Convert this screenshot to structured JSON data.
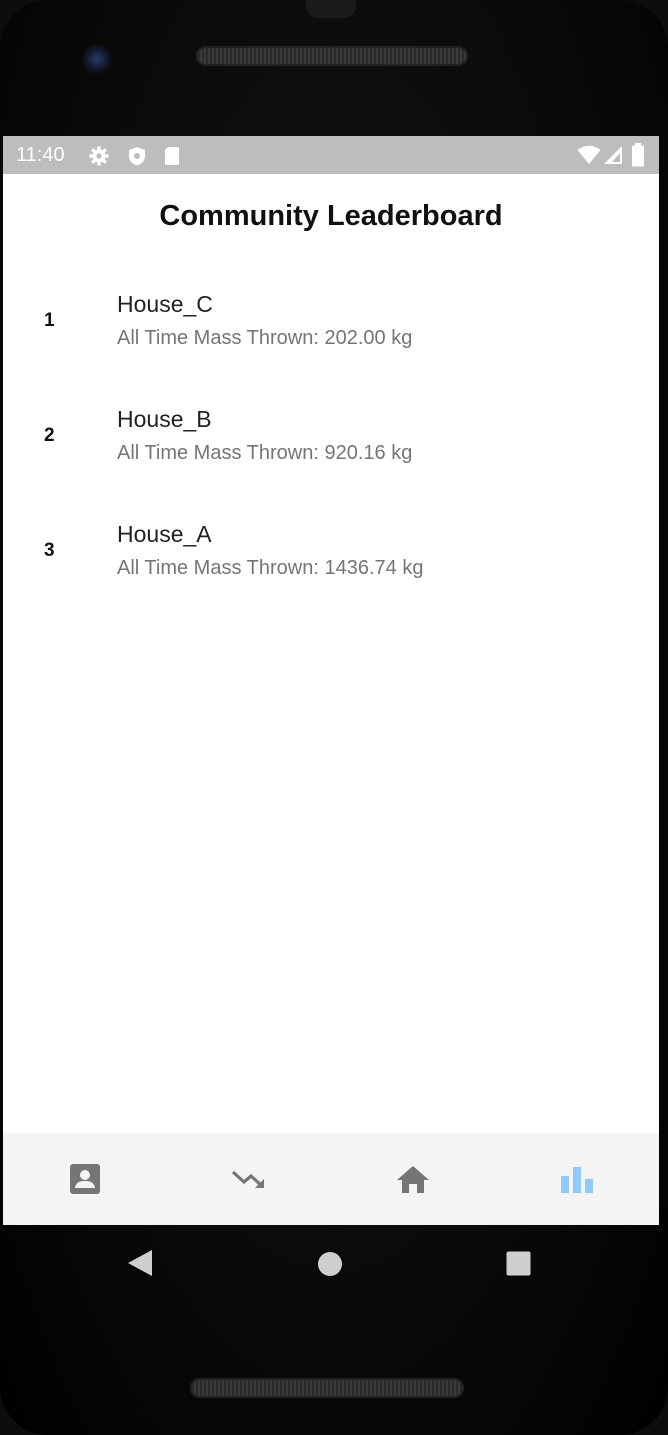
{
  "status_bar": {
    "time": "11:40",
    "left_icons": [
      "gear-icon",
      "shield-icon",
      "sd-card-icon"
    ],
    "right_icons": [
      "wifi-icon",
      "signal-icon",
      "battery-icon"
    ]
  },
  "app": {
    "title": "Community Leaderboard"
  },
  "leaderboard": [
    {
      "rank": "1",
      "name": "House_C",
      "detail": "All Time Mass Thrown: 202.00 kg"
    },
    {
      "rank": "2",
      "name": "House_B",
      "detail": "All Time Mass Thrown: 920.16 kg"
    },
    {
      "rank": "3",
      "name": "House_A",
      "detail": "All Time Mass Thrown: 1436.74 kg"
    }
  ],
  "bottom_nav": {
    "items": [
      {
        "icon": "account-box-icon",
        "active": false
      },
      {
        "icon": "trending-down-icon",
        "active": false
      },
      {
        "icon": "home-icon",
        "active": false
      },
      {
        "icon": "leaderboard-icon",
        "active": true
      }
    ],
    "active_color": "#90caf9",
    "inactive_color": "#757575"
  },
  "system_nav": [
    "back-icon",
    "home-circle-icon",
    "recents-icon"
  ]
}
